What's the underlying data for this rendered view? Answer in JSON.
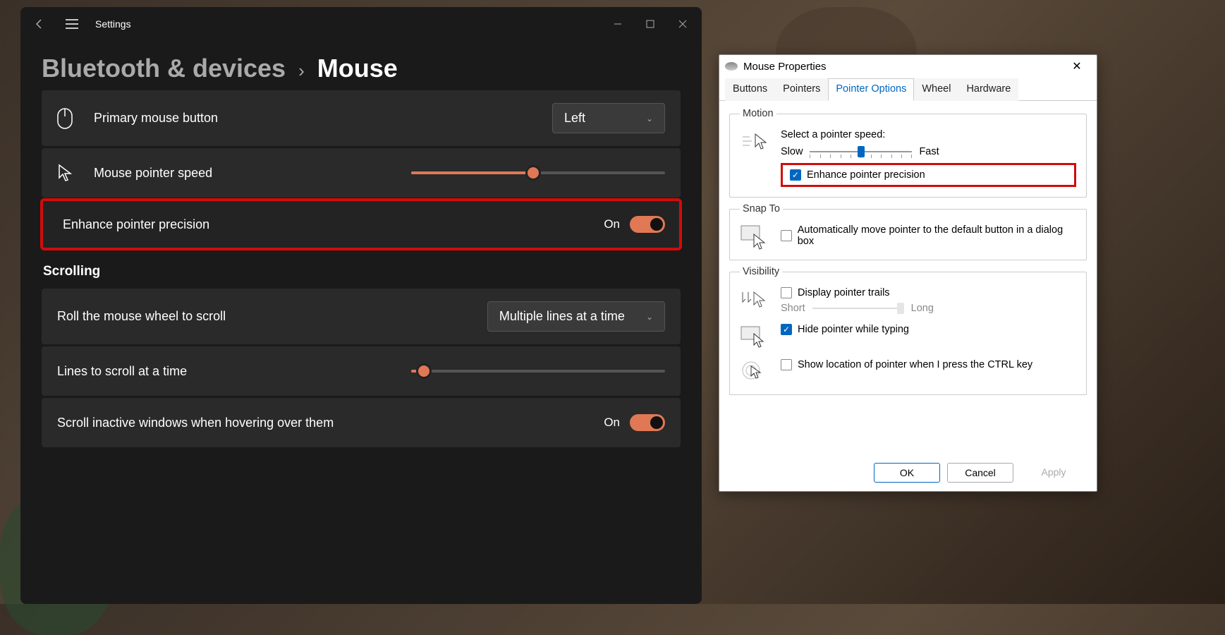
{
  "settings": {
    "title": "Settings",
    "breadcrumb_parent": "Bluetooth & devices",
    "breadcrumb_current": "Mouse",
    "primary_button": {
      "label": "Primary mouse button",
      "value": "Left"
    },
    "pointer_speed": {
      "label": "Mouse pointer speed",
      "value_pct": 48
    },
    "enhance": {
      "label": "Enhance pointer precision",
      "state": "On"
    },
    "section_scrolling": "Scrolling",
    "roll_wheel": {
      "label": "Roll the mouse wheel to scroll",
      "value": "Multiple lines at a time"
    },
    "lines_scroll": {
      "label": "Lines to scroll at a time",
      "value_pct": 5
    },
    "scroll_inactive": {
      "label": "Scroll inactive windows when hovering over them",
      "state": "On"
    }
  },
  "dialog": {
    "title": "Mouse Properties",
    "tabs": [
      "Buttons",
      "Pointers",
      "Pointer Options",
      "Wheel",
      "Hardware"
    ],
    "active_tab": "Pointer Options",
    "motion": {
      "legend": "Motion",
      "speed_label": "Select a pointer speed:",
      "slow": "Slow",
      "fast": "Fast",
      "speed_pct": 50,
      "enhance_label": "Enhance pointer precision",
      "enhance_checked": true
    },
    "snap": {
      "legend": "Snap To",
      "auto_label": "Automatically move pointer to the default button in a dialog box",
      "auto_checked": false
    },
    "visibility": {
      "legend": "Visibility",
      "trails_label": "Display pointer trails",
      "trails_checked": false,
      "short": "Short",
      "long": "Long",
      "hide_label": "Hide pointer while typing",
      "hide_checked": true,
      "ctrl_label": "Show location of pointer when I press the CTRL key",
      "ctrl_checked": false
    },
    "buttons": {
      "ok": "OK",
      "cancel": "Cancel",
      "apply": "Apply"
    }
  }
}
